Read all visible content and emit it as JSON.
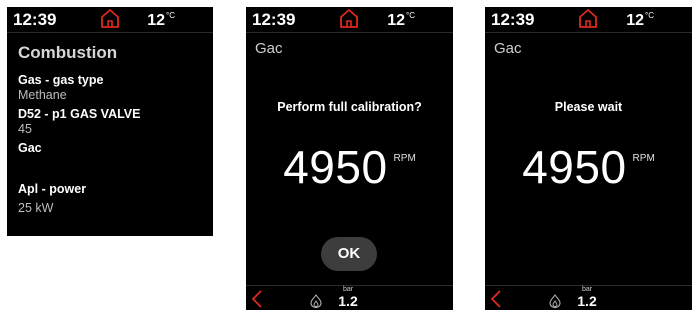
{
  "header": {
    "time": "12:39",
    "temperature": "12",
    "temp_unit": "°C"
  },
  "screen1": {
    "title": "Combustion",
    "params": [
      {
        "label": "Gas - gas type",
        "value": "Methane"
      },
      {
        "label": "D52 - p1 GAS VALVE",
        "value": "45"
      },
      {
        "label": "Gac",
        "value": ""
      },
      {
        "label": "Apl - power",
        "value": "25 kW"
      }
    ]
  },
  "screen2": {
    "title": "Gac",
    "message": "Perform full calibration?",
    "rpm": "4950",
    "rpm_unit": "RPM",
    "ok_label": "OK"
  },
  "screen3": {
    "title": "Gac",
    "message": "Please wait",
    "rpm": "4950",
    "rpm_unit": "RPM"
  },
  "footer": {
    "pressure_unit": "bar",
    "pressure_value": "1.2"
  },
  "colors": {
    "background": "#000000",
    "accent_red": "#e0281e",
    "ok_button": "#3d3d3d"
  },
  "icons": [
    "home-icon",
    "back-arrow-icon",
    "flame-icon"
  ]
}
